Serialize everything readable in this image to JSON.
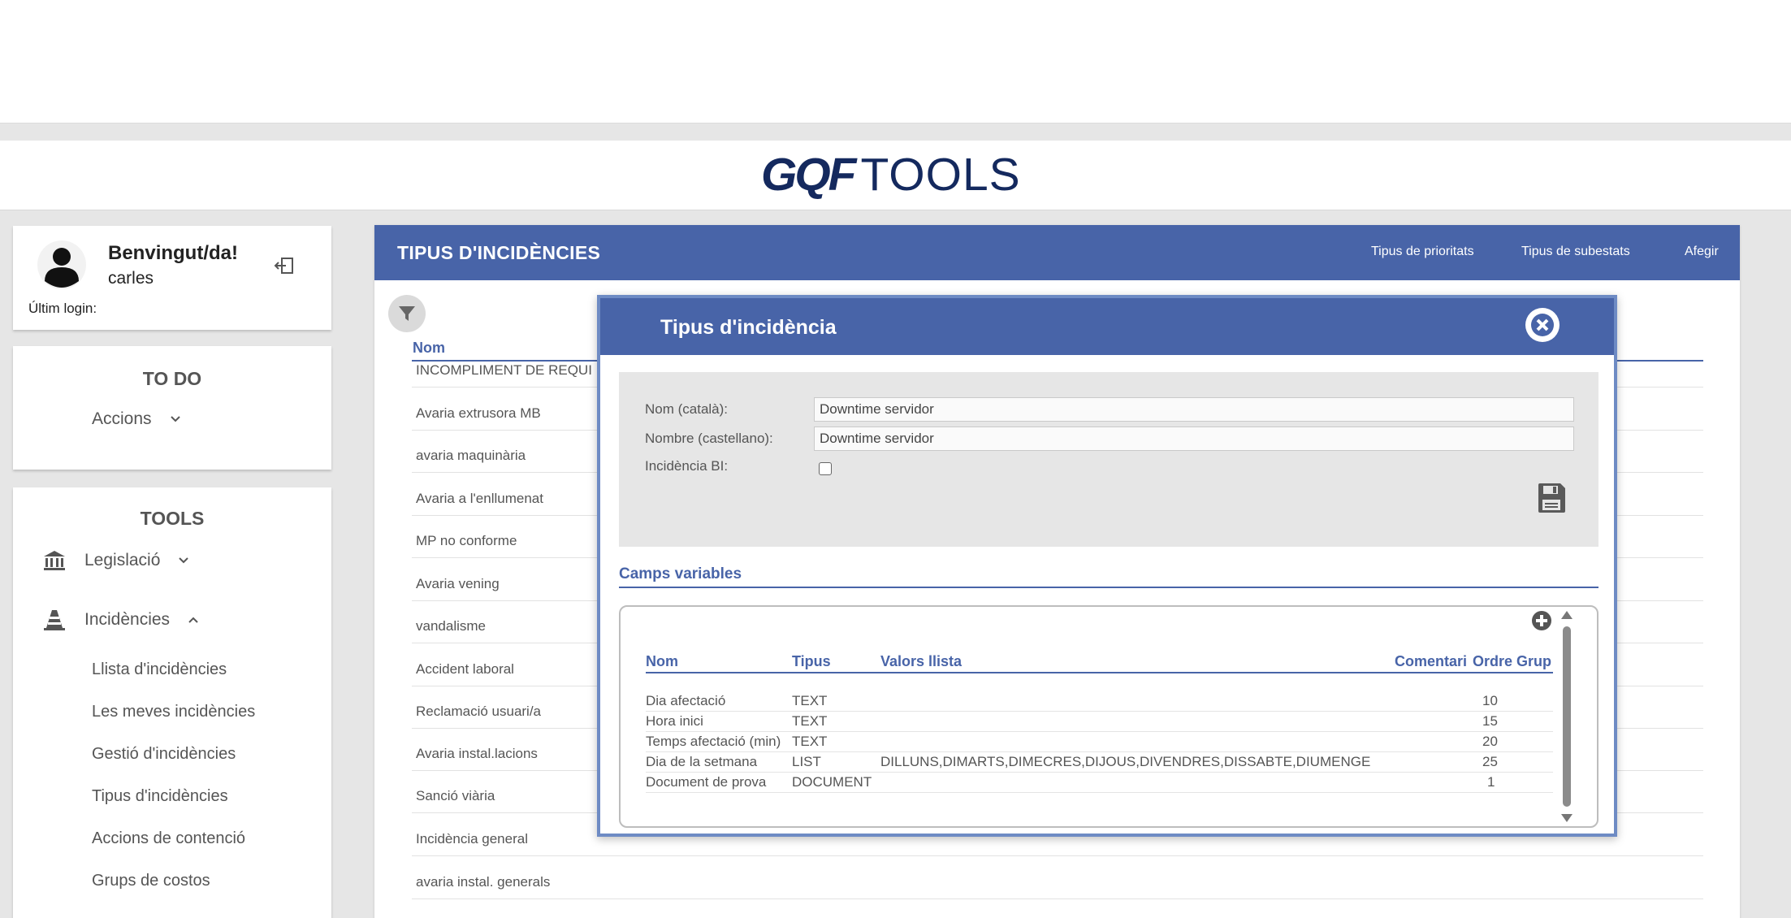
{
  "brand": {
    "logo_bold": "GQF",
    "logo_light": "TOOLS"
  },
  "user": {
    "welcome": "Benvingut/da!",
    "name": "carles",
    "last_login_label": "Últim login:"
  },
  "todo": {
    "title": "TO DO",
    "actions_label": "Accions"
  },
  "tools": {
    "title": "TOOLS",
    "legislacio_label": "Legislació",
    "incidencies_label": "Incidències",
    "subitems": [
      "Llista d'incidències",
      "Les meves incidències",
      "Gestió d'incidències",
      "Tipus d'incidències",
      "Accions de contenció",
      "Grups de costos"
    ]
  },
  "panel": {
    "title": "TIPUS D'INCIDÈNCIES",
    "links": [
      "Tipus de prioritats",
      "Tipus de subestats",
      "Afegir"
    ],
    "column_name": "Nom",
    "rows": [
      "INCOMPLIMENT DE REQUI",
      "Avaria extrusora MB",
      "avaria maquinària",
      "Avaria a l'enllumenat",
      "MP no conforme",
      "Avaria vening",
      "vandalisme",
      "Accident laboral",
      "Reclamació usuari/a",
      "Avaria instal.lacions",
      "Sanció viària",
      "Incidència general",
      "avaria instal. generals"
    ]
  },
  "modal": {
    "title": "Tipus d'incidència",
    "form": {
      "nom_label": "Nom (català):",
      "nom_value": "Downtime servidor",
      "nombre_label": "Nombre (castellano):",
      "nombre_value": "Downtime servidor",
      "bi_label": "Incidència BI:",
      "bi_checked": false
    },
    "camps_title": "Camps variables",
    "grid": {
      "headers": [
        "Nom",
        "Tipus",
        "Valors llista",
        "Comentari",
        "Ordre",
        "Grup"
      ],
      "rows": [
        [
          "Dia afectació",
          "TEXT",
          "",
          "",
          "10",
          ""
        ],
        [
          "Hora inici",
          "TEXT",
          "",
          "",
          "15",
          ""
        ],
        [
          "Temps afectació (min)",
          "TEXT",
          "",
          "",
          "20",
          ""
        ],
        [
          "Dia de la setmana",
          "LIST",
          "DILLUNS,DIMARTS,DIMECRES,DIJOUS,DIVENDRES,DISSABTE,DIUMENGE",
          "",
          "25",
          ""
        ],
        [
          "Document de prova",
          "DOCUMENT",
          "",
          "",
          "1",
          ""
        ]
      ]
    }
  },
  "colors": {
    "header_blue": "#4864a8",
    "modal_border": "#6e8bc4",
    "logo_navy": "#14295e",
    "logo_accent": "#3b8fd6"
  }
}
